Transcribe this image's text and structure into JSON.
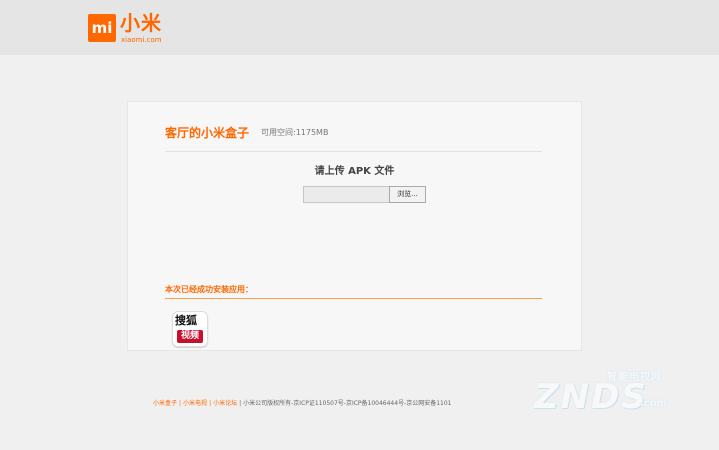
{
  "header": {
    "logo_mark": "mi",
    "logo_name": "小米",
    "logo_domain": "xiaomi.com"
  },
  "panel": {
    "device_title": "客厅的小米盒子",
    "space_text": "可用空间:1175MB",
    "upload_heading": "请上传 APK 文件",
    "browse_label": "浏览...",
    "installed_label": "本次已经成功安装应用：",
    "apps": [
      {
        "name_top": "搜狐",
        "name_bottom": "视频"
      }
    ]
  },
  "footer": {
    "links": [
      "小米盒子",
      "小米电视",
      "小米论坛"
    ],
    "separator": "|",
    "copyright": "小米公司版权所有-京ICP证110507号-京ICP备10046444号-京公网安备1101"
  },
  "watermark": {
    "main": "ZNDS",
    "sub": "智能电视网",
    "domain": ".com"
  },
  "colors": {
    "brand": "#ff6700",
    "page_bg": "#f0f0f0",
    "header_bg": "#e5e5e5",
    "panel_bg": "#f7f7f7"
  }
}
